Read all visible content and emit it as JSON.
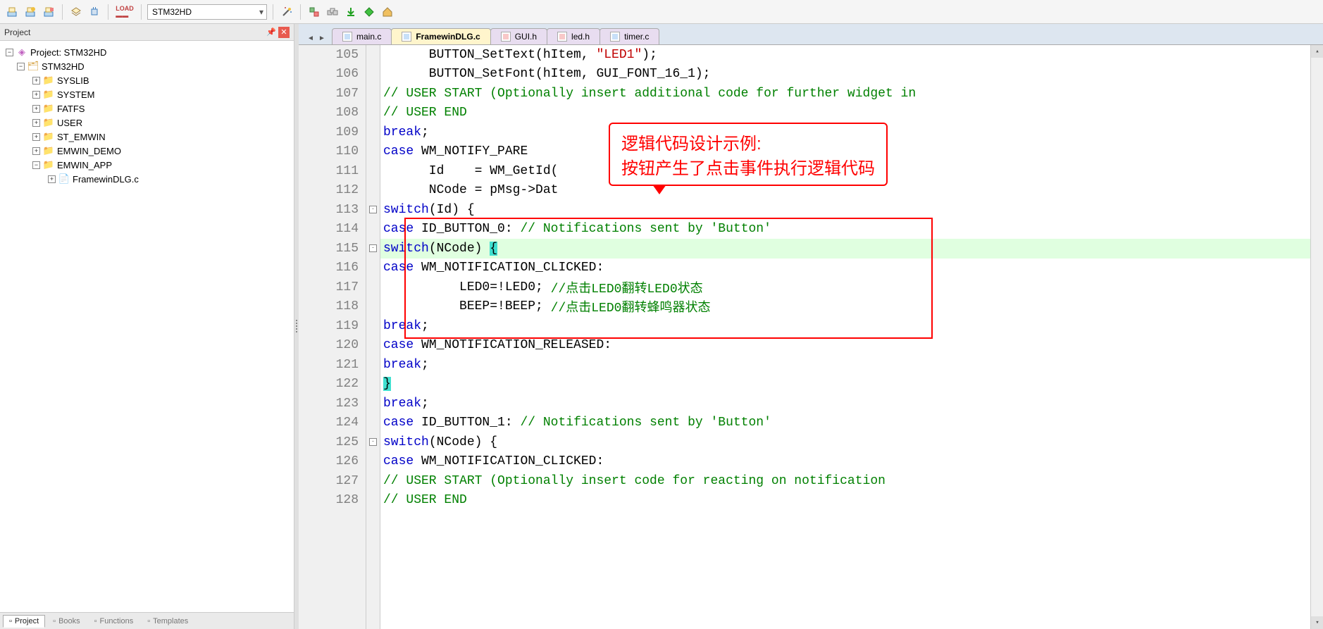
{
  "toolbar": {
    "target_select": "STM32HD"
  },
  "sidebar": {
    "title": "Project",
    "root": "Project: STM32HD",
    "target": "STM32HD",
    "folders": [
      "SYSLIB",
      "SYSTEM",
      "FATFS",
      "USER",
      "ST_EMWIN",
      "EMWIN_DEMO",
      "EMWIN_APP"
    ],
    "file_under_app": "FramewinDLG.c",
    "tabs": [
      "Project",
      "Books",
      "Functions",
      "Templates"
    ]
  },
  "editor": {
    "tabs": [
      {
        "name": "main.c",
        "type": "c"
      },
      {
        "name": "FramewinDLG.c",
        "type": "c",
        "active": true
      },
      {
        "name": "GUI.h",
        "type": "h"
      },
      {
        "name": "led.h",
        "type": "h"
      },
      {
        "name": "timer.c",
        "type": "c"
      }
    ],
    "first_line": 105,
    "lines": [
      {
        "n": 105,
        "html": "      BUTTON_SetText(hItem, <span class='str'>\"LED1\"</span>);"
      },
      {
        "n": 106,
        "html": "      BUTTON_SetFont(hItem, GUI_FONT_16_1);"
      },
      {
        "n": 107,
        "html": "      <span class='cmt'>// USER START (Optionally insert additional code for further widget in</span>"
      },
      {
        "n": 108,
        "html": "      <span class='cmt'>// USER END</span>"
      },
      {
        "n": 109,
        "html": "      <span class='kw'>break</span>;"
      },
      {
        "n": 110,
        "html": "    <span class='kw'>case</span> WM_NOTIFY_PARE"
      },
      {
        "n": 111,
        "html": "      Id    = WM_GetId("
      },
      {
        "n": 112,
        "html": "      NCode = pMsg->Dat"
      },
      {
        "n": 113,
        "fold": "-",
        "html": "      <span class='kw'>switch</span>(Id) {"
      },
      {
        "n": 114,
        "html": "      <span class='kw'>case</span> ID_BUTTON_0: <span class='cmt'>// Notifications sent by 'Button'</span>"
      },
      {
        "n": 115,
        "fold": "-",
        "hl": true,
        "html": "        <span class='kw'>switch</span>(NCode) <span class='brace-hl'>{</span>"
      },
      {
        "n": 116,
        "html": "        <span class='kw'>case</span> WM_NOTIFICATION_CLICKED:"
      },
      {
        "n": 117,
        "html": "          LED0=!LED0; <span class='cmt'>//点击LED0翻转LED0状态</span>"
      },
      {
        "n": 118,
        "html": "          BEEP=!BEEP; <span class='cmt'>//点击LED0翻转蜂鸣器状态</span>"
      },
      {
        "n": 119,
        "html": "          <span class='kw'>break</span>;"
      },
      {
        "n": 120,
        "html": "        <span class='kw'>case</span> WM_NOTIFICATION_RELEASED:"
      },
      {
        "n": 121,
        "html": "          <span class='kw'>break</span>;"
      },
      {
        "n": 122,
        "html": "        <span class='brace-hl'>}</span>"
      },
      {
        "n": 123,
        "html": "        <span class='kw'>break</span>;"
      },
      {
        "n": 124,
        "html": "      <span class='kw'>case</span> ID_BUTTON_1: <span class='cmt'>// Notifications sent by 'Button'</span>"
      },
      {
        "n": 125,
        "fold": "-",
        "html": "        <span class='kw'>switch</span>(NCode) {"
      },
      {
        "n": 126,
        "html": "        <span class='kw'>case</span> WM_NOTIFICATION_CLICKED:"
      },
      {
        "n": 127,
        "html": "          <span class='cmt'>// USER START (Optionally insert code for reacting on notification</span>"
      },
      {
        "n": 128,
        "html": "          <span class='cmt'>// USER END</span>"
      }
    ]
  },
  "annotation": {
    "line1": "逻辑代码设计示例:",
    "line2": "按钮产生了点击事件执行逻辑代码"
  }
}
